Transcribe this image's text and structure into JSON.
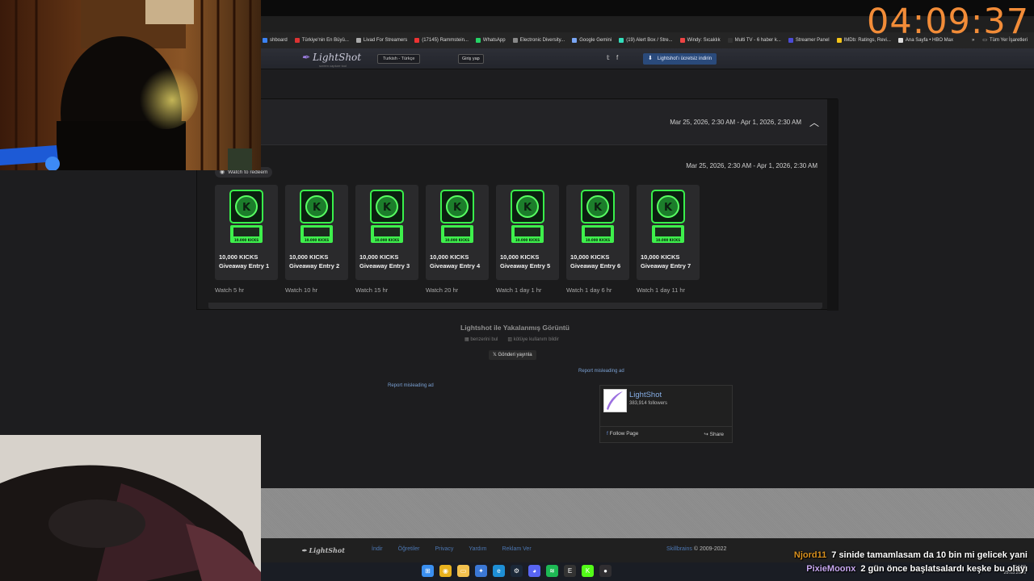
{
  "timer": "04:09:37",
  "bookmarks": [
    {
      "label": "shboard",
      "color": "#3b82f6"
    },
    {
      "label": "Türkiye'nin En Büyü...",
      "color": "#d33"
    },
    {
      "label": "Livad For Streamers",
      "color": "#aaa"
    },
    {
      "label": "(17145) Rammstein...",
      "color": "#e33"
    },
    {
      "label": "WhatsApp",
      "color": "#25d366"
    },
    {
      "label": "Electronic Diversity...",
      "color": "#888"
    },
    {
      "label": "Google Gemini",
      "color": "#7aa6f5"
    },
    {
      "label": "(19) Alert Box / Stre...",
      "color": "#3db"
    },
    {
      "label": "Windy: Sıcaklık",
      "color": "#e44"
    },
    {
      "label": "Multi TV - 6 haber k...",
      "color": "#333"
    },
    {
      "label": "Streamer Panel",
      "color": "#4b4bd6"
    },
    {
      "label": "IMDb: Ratings, Revi...",
      "color": "#f5c518"
    },
    {
      "label": "Ana Sayfa • HBO Max",
      "color": "#ddd"
    }
  ],
  "bookmarks_more": "»",
  "bookmarks_all": "Tüm Yer İşaretleri",
  "lightshot": {
    "logo": "LightShot",
    "logo_sub": "screen capture tool",
    "language": "Turkish - Türkçe",
    "login": "Giriş yap",
    "social": "𝕪  f",
    "download": "Lightshot'ı ücretsiz indirin"
  },
  "card": {
    "range_top": "Mar 25, 2026, 2:30 AM - Apr 1, 2026, 2:30 AM",
    "range": "Mar 25, 2026, 2:30 AM - Apr 1, 2026, 2:30 AM",
    "watch_label": "Watch to redeem",
    "rewards": [
      {
        "line1": "10,000 KICKS",
        "line2": "Giveaway Entry 1",
        "req": "Watch 5 hr",
        "badge": "10.000 KICKS"
      },
      {
        "line1": "10,000 KICKS",
        "line2": "Giveaway Entry 2",
        "req": "Watch 10 hr",
        "badge": "10.000 KICKS"
      },
      {
        "line1": "10,000 KICKS",
        "line2": "Giveaway Entry 3",
        "req": "Watch 15 hr",
        "badge": "10.000 KICKS"
      },
      {
        "line1": "10,000 KICKS",
        "line2": "Giveaway Entry 4",
        "req": "Watch 20 hr",
        "badge": "10.000 KICKS"
      },
      {
        "line1": "10,000 KICKS",
        "line2": "Giveaway Entry 5",
        "req": "Watch 1 day 1 hr",
        "badge": "10.000 KICKS"
      },
      {
        "line1": "10,000 KICKS",
        "line2": "Giveaway Entry 6",
        "req": "Watch 1 day 6 hr",
        "badge": "10.000 KICKS"
      },
      {
        "line1": "10,000 KICKS",
        "line2": "Giveaway Entry 7",
        "req": "Watch 1 day 11 hr",
        "badge": "10.000 KICKS"
      }
    ]
  },
  "below": {
    "caption": "Lightshot ile Yakalanmış Görüntü",
    "similar": "benzerini bul",
    "report_abuse": "kötüye kullanım bildir",
    "tweet": "𝕏 Gönderi yayınla",
    "report_ad_1": "Report misleading ad",
    "report_ad_2": "Report misleading ad"
  },
  "facebook": {
    "name": "LightShot",
    "followers": "383,914 followers",
    "follow": "Follow Page",
    "share": "Share"
  },
  "footer": {
    "logo": "LightShot",
    "links": [
      "İndir",
      "Öğretiler",
      "Privacy",
      "Yardım",
      "Reklam Ver"
    ],
    "brand": "Skillbrains",
    "copy": "© 2009-2022"
  },
  "chat": [
    {
      "user": "Njord11",
      "message": "7 sinide tamamlasam da 10 bin mi gelicek yani"
    },
    {
      "user": "PixieMoonx",
      "message": "2 gün önce başlatsalardı keşke bu olayı"
    }
  ],
  "taskbar": {
    "time": "14:50",
    "date": "25.03.2026",
    "icons": [
      {
        "name": "windows",
        "color": "#3a8ff0",
        "glyph": "⊞"
      },
      {
        "name": "chrome",
        "color": "#e8b21e",
        "glyph": "◉"
      },
      {
        "name": "explorer",
        "color": "#f2c14e",
        "glyph": "▭"
      },
      {
        "name": "app-blue",
        "color": "#3b78d6",
        "glyph": "✦"
      },
      {
        "name": "edge",
        "color": "#1e8fd6",
        "glyph": "e"
      },
      {
        "name": "steam",
        "color": "#1b2838",
        "glyph": "⚙"
      },
      {
        "name": "discord",
        "color": "#5865f2",
        "glyph": "◕"
      },
      {
        "name": "spotify",
        "color": "#1db954",
        "glyph": "≋"
      },
      {
        "name": "epic",
        "color": "#333",
        "glyph": "E"
      },
      {
        "name": "kick",
        "color": "#53fc18",
        "glyph": "K"
      },
      {
        "name": "obs",
        "color": "#302e31",
        "glyph": "●"
      }
    ]
  }
}
